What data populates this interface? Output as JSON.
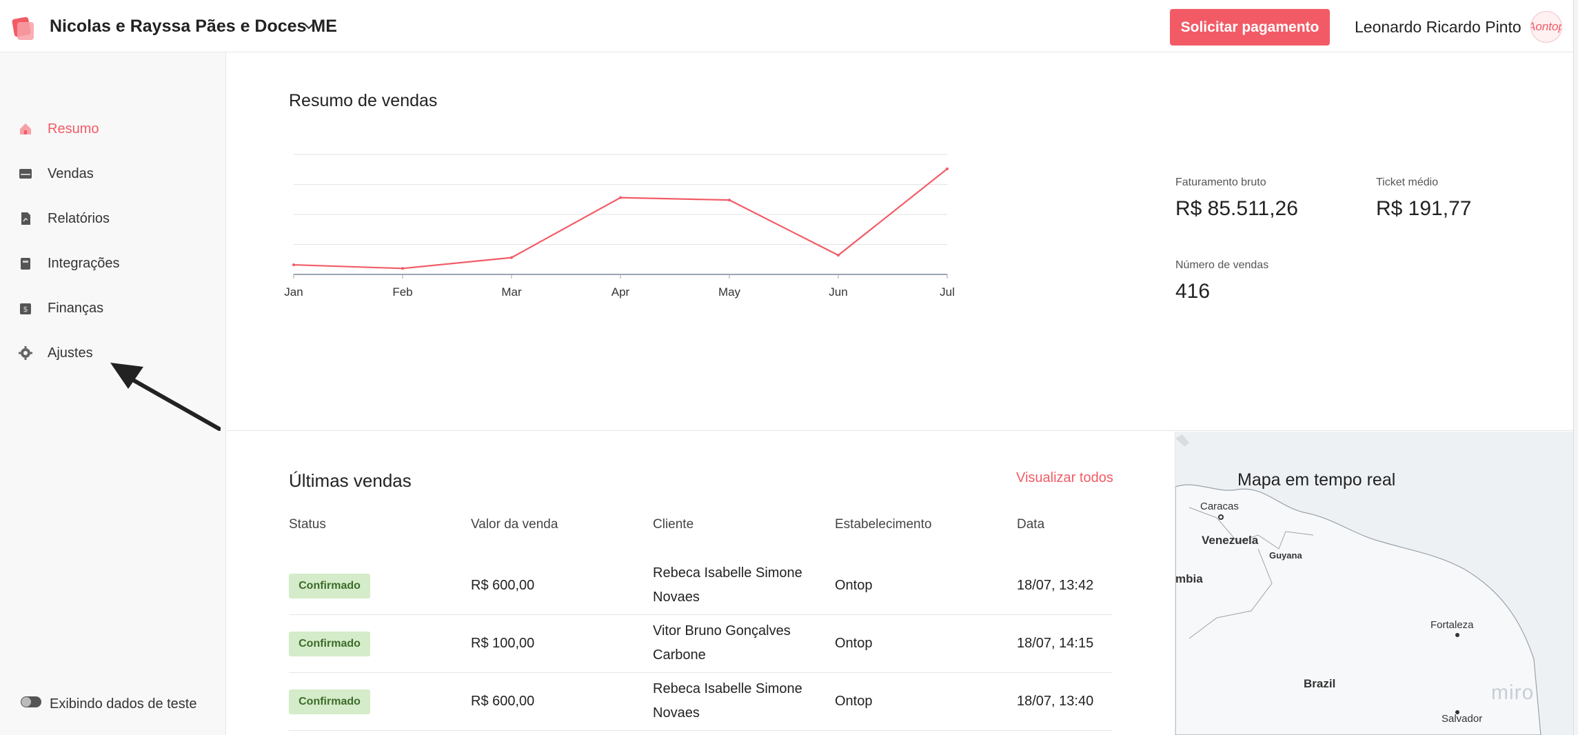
{
  "header": {
    "company": "Nicolas e Rayssa Pães e Doces ME",
    "pay_button": "Solicitar pagamento",
    "user_name": "Leonardo Ricardo Pinto",
    "avatar_text": "Aontop"
  },
  "sidebar": {
    "items": [
      {
        "label": "Resumo",
        "icon": "home-icon",
        "active": true
      },
      {
        "label": "Vendas",
        "icon": "wallet-icon",
        "active": false
      },
      {
        "label": "Relatórios",
        "icon": "report-icon",
        "active": false
      },
      {
        "label": "Integrações",
        "icon": "integration-icon",
        "active": false
      },
      {
        "label": "Finanças",
        "icon": "finance-icon",
        "active": false
      },
      {
        "label": "Ajustes",
        "icon": "gear-icon",
        "active": false
      }
    ],
    "test_toggle_label": "Exibindo dados de teste"
  },
  "sales_summary": {
    "title": "Resumo de vendas",
    "kpis": {
      "gross_label": "Faturamento bruto",
      "gross_value": "R$ 85.511,26",
      "ticket_label": "Ticket médio",
      "ticket_value": "R$ 191,77",
      "count_label": "Número de vendas",
      "count_value": "416"
    }
  },
  "chart_data": {
    "type": "line",
    "categories": [
      "Jan",
      "Feb",
      "Mar",
      "Apr",
      "May",
      "Jun",
      "Jul"
    ],
    "series": [
      {
        "values": [
          0.4,
          0.25,
          0.7,
          3.2,
          3.1,
          0.8,
          4.4
        ]
      }
    ],
    "ylim": [
      0,
      5
    ],
    "grid": true,
    "color": "#f25b66"
  },
  "latest_sales": {
    "title": "Últimas vendas",
    "view_all": "Visualizar todos",
    "columns": [
      "Status",
      "Valor da venda",
      "Cliente",
      "Estabelecimento",
      "Data"
    ],
    "rows": [
      {
        "status": "Confirmado",
        "value": "R$ 600,00",
        "client_line1": "Rebeca Isabelle Simone",
        "client_line2": "Novaes",
        "establishment": "Ontop",
        "date": "18/07, 13:42"
      },
      {
        "status": "Confirmado",
        "value": "R$ 100,00",
        "client_line1": "Vitor Bruno Gonçalves",
        "client_line2": "Carbone",
        "establishment": "Ontop",
        "date": "18/07, 14:15"
      },
      {
        "status": "Confirmado",
        "value": "R$ 600,00",
        "client_line1": "Rebeca Isabelle Simone",
        "client_line2": "Novaes",
        "establishment": "Ontop",
        "date": "18/07, 13:40"
      }
    ]
  },
  "map": {
    "title": "Mapa em tempo real",
    "labels": {
      "caracas": "Caracas",
      "venezuela": "Venezuela",
      "guyana": "Guyana",
      "colombia_partial": "mbia",
      "fortaleza": "Fortaleza",
      "brazil": "Brazil",
      "salvador": "Salvador"
    },
    "watermark": "miro"
  },
  "colors": {
    "accent": "#f25b66",
    "badge_bg": "#d4ecc9",
    "badge_text": "#3d6b2a"
  }
}
